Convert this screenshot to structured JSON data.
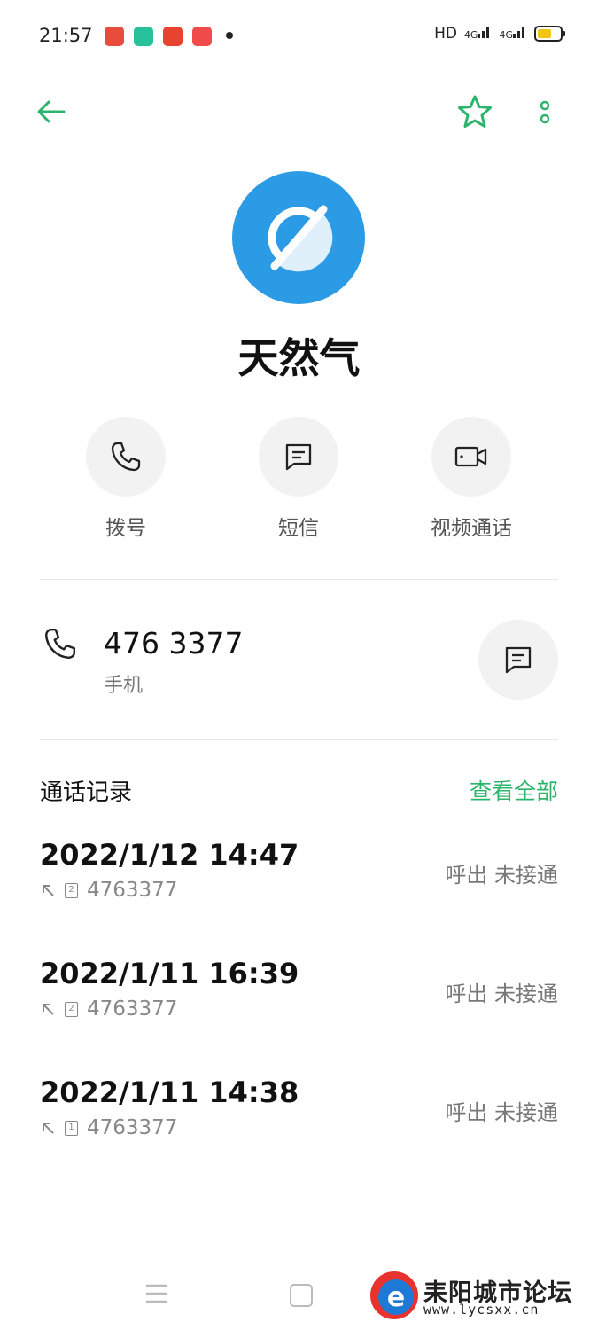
{
  "status_bar": {
    "time": "21:57",
    "network_text": "HD",
    "signal_1": "4G",
    "signal_2": "4G",
    "icons": [
      "toutiao-app-icon",
      "green-app-icon",
      "taobao-app-icon",
      "video-app-icon"
    ]
  },
  "header": {
    "back_icon": "arrow-left-icon",
    "favorite_icon": "star-outline-icon",
    "more_icon": "vertical-dots-icon",
    "accent_color": "#2db46c"
  },
  "contact": {
    "name": "天然气",
    "avatar_color": "#2a9be4"
  },
  "actions": [
    {
      "label": "拨号",
      "icon": "phone-icon"
    },
    {
      "label": "短信",
      "icon": "message-icon"
    },
    {
      "label": "视频通话",
      "icon": "video-camera-icon"
    }
  ],
  "phone": {
    "number": "476 3377",
    "type": "手机"
  },
  "history": {
    "title": "通话记录",
    "view_all": "查看全部",
    "calls": [
      {
        "datetime": "2022/1/12 14:47",
        "sim": "2",
        "number": "4763377",
        "status": "呼出 未接通"
      },
      {
        "datetime": "2022/1/11 16:39",
        "sim": "2",
        "number": "4763377",
        "status": "呼出 未接通"
      },
      {
        "datetime": "2022/1/11 14:38",
        "sim": "1",
        "number": "4763377",
        "status": "呼出 未接通"
      }
    ]
  },
  "watermark": {
    "title": "耒阳城市论坛",
    "url": "www.lycsxx.cn"
  }
}
